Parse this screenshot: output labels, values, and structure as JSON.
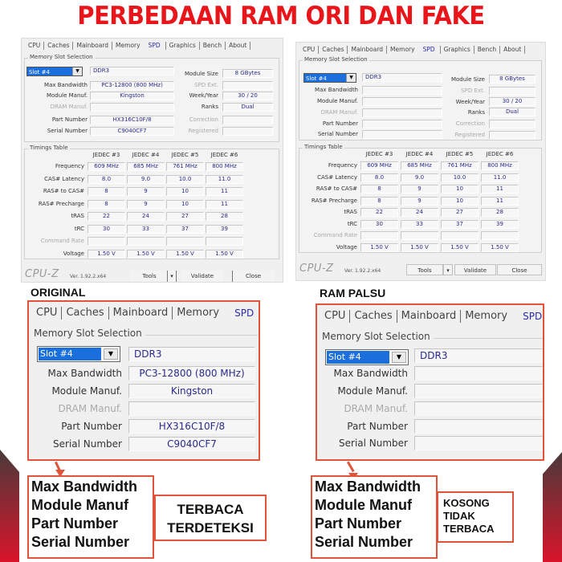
{
  "title": "PERBEDAAN RAM ORI DAN FAKE",
  "tabs": [
    "CPU",
    "Caches",
    "Mainboard",
    "Memory",
    "SPD",
    "Graphics",
    "Bench",
    "About"
  ],
  "big_tabs": [
    "CPU",
    "Caches",
    "Mainboard",
    "Memory",
    "SPD"
  ],
  "memory_slot_selection_label": "Memory Slot Selection",
  "timings_table_label": "Timings Table",
  "labels": {
    "max_bandwidth": "Max Bandwidth",
    "module_manuf": "Module Manuf.",
    "dram_manuf": "DRAM Manuf.",
    "part_number": "Part Number",
    "serial_number": "Serial Number",
    "module_size": "Module Size",
    "spd_ext": "SPD Ext.",
    "week_year": "Week/Year",
    "ranks": "Ranks",
    "correction": "Correction",
    "registered": "Registered"
  },
  "timing_rows": [
    "Frequency",
    "CAS# Latency",
    "RAS# to CAS#",
    "RAS# Precharge",
    "tRAS",
    "tRC",
    "Command Rate",
    "Voltage"
  ],
  "timing_cols": [
    "JEDEC #3",
    "JEDEC #4",
    "JEDEC #5",
    "JEDEC #6"
  ],
  "timing_values": [
    [
      "609 MHz",
      "685 MHz",
      "761 MHz",
      "800 MHz"
    ],
    [
      "8.0",
      "9.0",
      "10.0",
      "11.0"
    ],
    [
      "8",
      "9",
      "10",
      "11"
    ],
    [
      "8",
      "9",
      "10",
      "11"
    ],
    [
      "22",
      "24",
      "27",
      "28"
    ],
    [
      "30",
      "33",
      "37",
      "39"
    ],
    [
      "",
      "",
      "",
      ""
    ],
    [
      "1.50 V",
      "1.50 V",
      "1.50 V",
      "1.50 V"
    ]
  ],
  "original": {
    "slot": "Slot #4",
    "type": "DDR3",
    "max_bandwidth": "PC3-12800 (800 MHz)",
    "module_manuf": "Kingston",
    "dram_manuf": "",
    "part_number": "HX316C10F/8",
    "serial_number": "C9040CF7",
    "module_size": "8 GBytes",
    "spd_ext": "",
    "week_year": "30 / 20",
    "ranks": "Dual",
    "correction": "",
    "registered": ""
  },
  "fake": {
    "slot": "Slot #4",
    "type": "DDR3",
    "max_bandwidth": "",
    "module_manuf": "",
    "dram_manuf": "",
    "part_number": "",
    "serial_number": "",
    "module_size": "8 GBytes",
    "spd_ext": "",
    "week_year": "30 / 20",
    "ranks": "Dual",
    "correction": "",
    "registered": ""
  },
  "footer": {
    "logo": "CPU-Z",
    "version": "Ver. 1.92.2.x64",
    "tools": "Tools",
    "validate": "Validate",
    "close": "Close"
  },
  "section_original": "ORIGINAL",
  "section_fake": "RAM PALSU",
  "summary_items": [
    "Max Bandwidth",
    "Module Manuf",
    "Part Number",
    "Serial Number"
  ],
  "note_original": [
    "TERBACA",
    "TERDETEKSI"
  ],
  "note_fake": [
    "KOSONG",
    "TIDAK",
    "TERBACA"
  ],
  "colors": {
    "title": "#e8161b",
    "highlight_border": "#e0553a",
    "value_text": "#2a2a8c",
    "selection": "#1a6fdc"
  }
}
